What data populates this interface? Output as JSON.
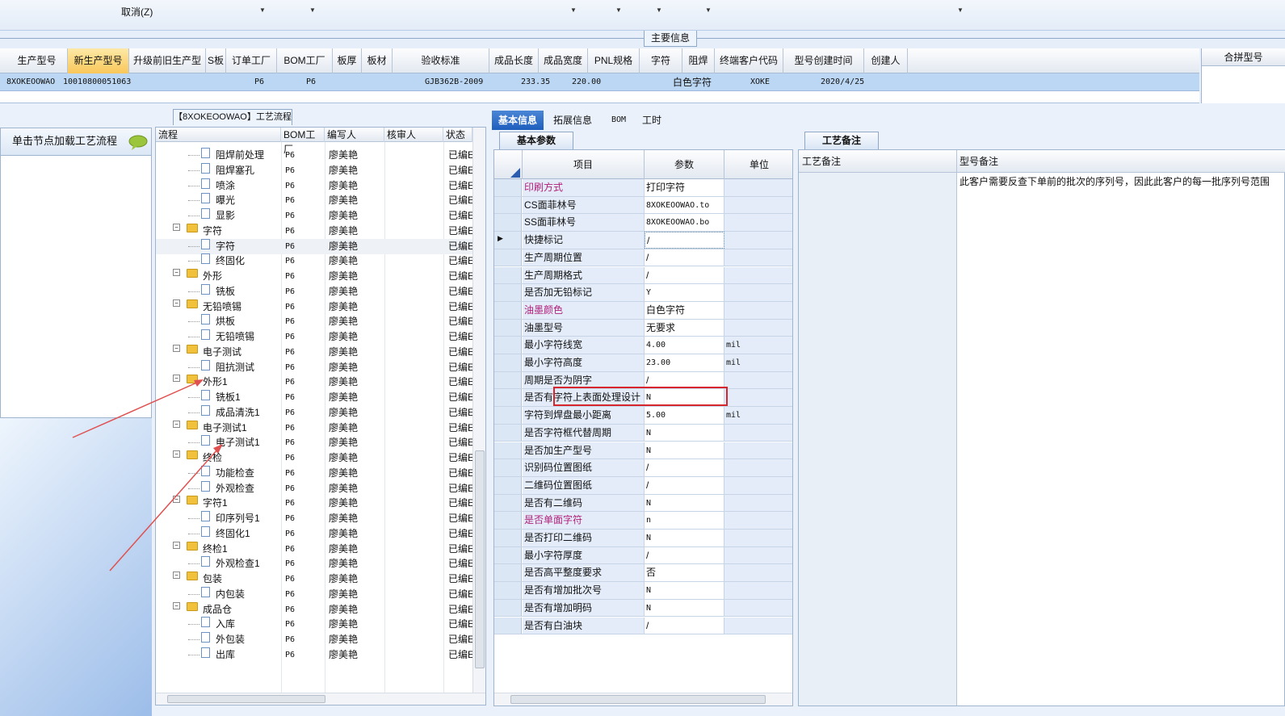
{
  "toolbar": {
    "cancel_label": "取消(Z)"
  },
  "main_info": {
    "section_title": "主要信息",
    "columns": [
      "生产型号",
      "新生产型号",
      "升级前旧生产型号",
      "S板",
      "订单工厂",
      "BOM工厂",
      "板厚",
      "板材",
      "验收标准",
      "成品长度",
      "成品宽度",
      "PNL规格",
      "字符",
      "阻焊",
      "终端客户代码",
      "型号创建时间",
      "创建人"
    ],
    "row": {
      "model": "8XOKEOOWAO",
      "new_model": "10010800051063",
      "order_factory": "P6",
      "bom_factory": "P6",
      "standard": "GJB362B-2009",
      "length": "233.35",
      "width": "220.00",
      "char": "白色字符",
      "customer": "XOKE",
      "created": "2020/4/25"
    },
    "combine_label": "合拼型号"
  },
  "left_panel": {
    "load_label": "单击节点加载工艺流程"
  },
  "flow": {
    "tab_label": "【8XOKEOOWAO】工艺流程",
    "headers": [
      "流程",
      "BOM工厂",
      "编写人",
      "核审人",
      "状态"
    ],
    "rows": [
      {
        "name": "阻焊前处理",
        "level": 2,
        "type": "doc",
        "bom": "P6",
        "writer": "廖美艳",
        "status": "已编E"
      },
      {
        "name": "阻焊塞孔",
        "level": 2,
        "type": "doc",
        "bom": "P6",
        "writer": "廖美艳",
        "status": "已编E"
      },
      {
        "name": "喷涂",
        "level": 2,
        "type": "doc",
        "bom": "P6",
        "writer": "廖美艳",
        "status": "已编E"
      },
      {
        "name": "曝光",
        "level": 2,
        "type": "doc",
        "bom": "P6",
        "writer": "廖美艳",
        "status": "已编E"
      },
      {
        "name": "显影",
        "level": 2,
        "type": "doc",
        "bom": "P6",
        "writer": "廖美艳",
        "status": "已编E"
      },
      {
        "name": "字符",
        "level": 1,
        "type": "folder",
        "bom": "P6",
        "writer": "廖美艳",
        "status": "已编E"
      },
      {
        "name": "字符",
        "level": 2,
        "type": "doc",
        "bom": "P6",
        "writer": "廖美艳",
        "status": "已编E"
      },
      {
        "name": "终固化",
        "level": 2,
        "type": "doc",
        "bom": "P6",
        "writer": "廖美艳",
        "status": "已编E"
      },
      {
        "name": "外形",
        "level": 1,
        "type": "folder",
        "bom": "P6",
        "writer": "廖美艳",
        "status": "已编E"
      },
      {
        "name": "铣板",
        "level": 2,
        "type": "doc",
        "bom": "P6",
        "writer": "廖美艳",
        "status": "已编E"
      },
      {
        "name": "无铅喷锡",
        "level": 1,
        "type": "folder",
        "bom": "P6",
        "writer": "廖美艳",
        "status": "已编E"
      },
      {
        "name": "烘板",
        "level": 2,
        "type": "doc",
        "bom": "P6",
        "writer": "廖美艳",
        "status": "已编E"
      },
      {
        "name": "无铅喷锡",
        "level": 2,
        "type": "doc",
        "bom": "P6",
        "writer": "廖美艳",
        "status": "已编E"
      },
      {
        "name": "电子测试",
        "level": 1,
        "type": "folder",
        "bom": "P6",
        "writer": "廖美艳",
        "status": "已编E"
      },
      {
        "name": "阻抗测试",
        "level": 2,
        "type": "doc",
        "bom": "P6",
        "writer": "廖美艳",
        "status": "已编E"
      },
      {
        "name": "外形1",
        "level": 1,
        "type": "folder",
        "bom": "P6",
        "writer": "廖美艳",
        "status": "已编E"
      },
      {
        "name": "铣板1",
        "level": 2,
        "type": "doc",
        "bom": "P6",
        "writer": "廖美艳",
        "status": "已编E"
      },
      {
        "name": "成品清洗1",
        "level": 2,
        "type": "doc",
        "bom": "P6",
        "writer": "廖美艳",
        "status": "已编E"
      },
      {
        "name": "电子测试1",
        "level": 1,
        "type": "folder",
        "bom": "P6",
        "writer": "廖美艳",
        "status": "已编E"
      },
      {
        "name": "电子测试1",
        "level": 2,
        "type": "doc",
        "bom": "P6",
        "writer": "廖美艳",
        "status": "已编E"
      },
      {
        "name": "终检",
        "level": 1,
        "type": "folder",
        "bom": "P6",
        "writer": "廖美艳",
        "status": "已编E"
      },
      {
        "name": "功能检查",
        "level": 2,
        "type": "doc",
        "bom": "P6",
        "writer": "廖美艳",
        "status": "已编E"
      },
      {
        "name": "外观检查",
        "level": 2,
        "type": "doc",
        "bom": "P6",
        "writer": "廖美艳",
        "status": "已编E"
      },
      {
        "name": "字符1",
        "level": 1,
        "type": "folder",
        "bom": "P6",
        "writer": "廖美艳",
        "status": "已编E"
      },
      {
        "name": "印序列号1",
        "level": 2,
        "type": "doc",
        "bom": "P6",
        "writer": "廖美艳",
        "status": "已编E"
      },
      {
        "name": "终固化1",
        "level": 2,
        "type": "doc",
        "bom": "P6",
        "writer": "廖美艳",
        "status": "已编E"
      },
      {
        "name": "终检1",
        "level": 1,
        "type": "folder",
        "bom": "P6",
        "writer": "廖美艳",
        "status": "已编E"
      },
      {
        "name": "外观检查1",
        "level": 2,
        "type": "doc",
        "bom": "P6",
        "writer": "廖美艳",
        "status": "已编E"
      },
      {
        "name": "包装",
        "level": 1,
        "type": "folder",
        "bom": "P6",
        "writer": "廖美艳",
        "status": "已编E"
      },
      {
        "name": "内包装",
        "level": 2,
        "type": "doc",
        "bom": "P6",
        "writer": "廖美艳",
        "status": "已编E"
      },
      {
        "name": "成品仓",
        "level": 1,
        "type": "folder",
        "bom": "P6",
        "writer": "廖美艳",
        "status": "已编E"
      },
      {
        "name": "入库",
        "level": 2,
        "type": "doc",
        "bom": "P6",
        "writer": "廖美艳",
        "status": "已编E"
      },
      {
        "name": "外包装",
        "level": 2,
        "type": "doc",
        "bom": "P6",
        "writer": "廖美艳",
        "status": "已编E"
      },
      {
        "name": "出库",
        "level": 2,
        "type": "doc",
        "bom": "P6",
        "writer": "廖美艳",
        "status": "已编E"
      }
    ]
  },
  "tabs": [
    "基本信息",
    "拓展信息",
    "BOM",
    "工时"
  ],
  "basic_params": {
    "title": "基本参数",
    "headers": [
      "项目",
      "参数",
      "单位"
    ],
    "rows": [
      {
        "item": "印刷方式",
        "value": "打印字符",
        "unit": "",
        "pink": true
      },
      {
        "item": "CS面菲林号",
        "value": "8XOKEOOWAO.to",
        "unit": "",
        "mono": true
      },
      {
        "item": "SS面菲林号",
        "value": "8XOKEOOWAO.bo",
        "unit": "",
        "mono": true
      },
      {
        "item": "快捷标记",
        "value": "/",
        "unit": ""
      },
      {
        "item": "生产周期位置",
        "value": "/",
        "unit": ""
      },
      {
        "item": "生产周期格式",
        "value": "/",
        "unit": ""
      },
      {
        "item": "是否加无铅标记",
        "value": "Y",
        "unit": "",
        "mono": true
      },
      {
        "item": "油墨颜色",
        "value": "白色字符",
        "unit": "",
        "pink": true
      },
      {
        "item": "油墨型号",
        "value": "无要求",
        "unit": ""
      },
      {
        "item": "最小字符线宽",
        "value": "4.00",
        "unit": "mil",
        "mono": true
      },
      {
        "item": "最小字符高度",
        "value": "23.00",
        "unit": "mil",
        "mono": true
      },
      {
        "item": "周期是否为阴字",
        "value": "/",
        "unit": ""
      },
      {
        "item": "是否有字符上表面处理设计",
        "value": "N",
        "unit": "",
        "mono": true
      },
      {
        "item": "字符到焊盘最小距离",
        "value": "5.00",
        "unit": "mil",
        "mono": true
      },
      {
        "item": "是否字符框代替周期",
        "value": "N",
        "unit": "",
        "mono": true
      },
      {
        "item": "是否加生产型号",
        "value": "N",
        "unit": "",
        "mono": true
      },
      {
        "item": "识别码位置图纸",
        "value": "/",
        "unit": ""
      },
      {
        "item": "二维码位置图纸",
        "value": "/",
        "unit": ""
      },
      {
        "item": "是否有二维码",
        "value": "N",
        "unit": "",
        "mono": true
      },
      {
        "item": "是否单面字符",
        "value": "n",
        "unit": "",
        "pink": true,
        "mono": true
      },
      {
        "item": "是否打印二维码",
        "value": "N",
        "unit": "",
        "mono": true
      },
      {
        "item": "最小字符厚度",
        "value": "/",
        "unit": ""
      },
      {
        "item": "是否高平整度要求",
        "value": "否",
        "unit": ""
      },
      {
        "item": "是否有增加批次号",
        "value": "N",
        "unit": "",
        "mono": true
      },
      {
        "item": "是否有增加明码",
        "value": "N",
        "unit": "",
        "mono": true
      },
      {
        "item": "是否有白油块",
        "value": "/",
        "unit": ""
      }
    ]
  },
  "notes": {
    "tab_label": "工艺备注",
    "process_note_header": "工艺备注",
    "model_note_header": "型号备注",
    "model_note_text": "此客户需要反查下单前的批次的序列号，因此此客户的每一批序列号范围"
  }
}
